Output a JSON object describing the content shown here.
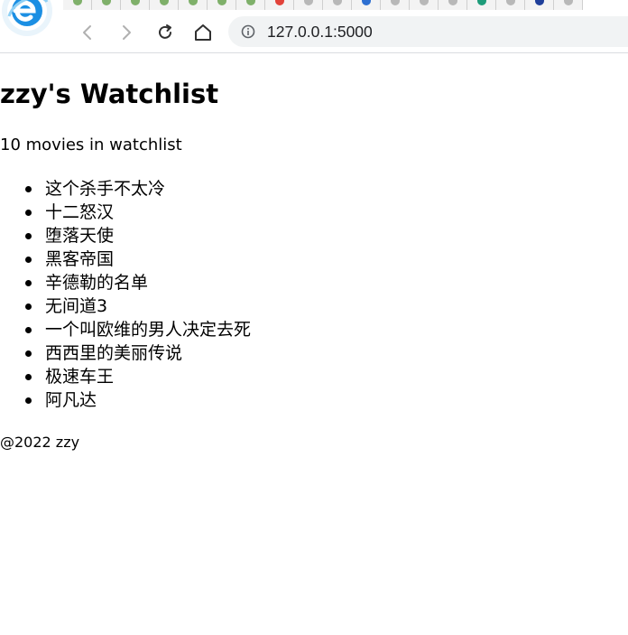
{
  "browser": {
    "url": "127.0.0.1:5000",
    "tabs": [
      {
        "icon": "tab-favicon",
        "color": "#7fb06a"
      },
      {
        "icon": "tab-favicon",
        "color": "#7fb06a"
      },
      {
        "icon": "tab-favicon",
        "color": "#7fb06a"
      },
      {
        "icon": "tab-favicon",
        "color": "#7fb06a"
      },
      {
        "icon": "tab-favicon",
        "color": "#7fb06a"
      },
      {
        "icon": "tab-favicon",
        "color": "#7fb06a"
      },
      {
        "icon": "tab-favicon",
        "color": "#7fb06a"
      },
      {
        "icon": "tab-favicon",
        "color": "#e2433a"
      },
      {
        "icon": "tab-favicon",
        "color": "#b8b8b8"
      },
      {
        "icon": "tab-favicon",
        "color": "#b8b8b8"
      },
      {
        "icon": "tab-favicon",
        "color": "#2d6fd1"
      },
      {
        "icon": "tab-favicon",
        "color": "#b8b8b8"
      },
      {
        "icon": "tab-favicon",
        "color": "#b8b8b8"
      },
      {
        "icon": "tab-favicon",
        "color": "#b8b8b8"
      },
      {
        "icon": "tab-favicon",
        "color": "#1e9c7a"
      },
      {
        "icon": "tab-favicon",
        "color": "#b8b8b8"
      },
      {
        "icon": "tab-favicon",
        "color": "#1f3f9a"
      },
      {
        "icon": "tab-favicon",
        "color": "#b8b8b8"
      }
    ],
    "icons": {
      "logo": "browser-logo-icon",
      "back": "arrow-left-icon",
      "forward": "arrow-right-icon",
      "reload": "reload-icon",
      "home": "home-icon",
      "info": "info-icon"
    },
    "colors": {
      "logo_blue": "#1b8fe3",
      "omnibox_bg": "#f1f3f4"
    }
  },
  "page": {
    "title": "zzy's Watchlist",
    "count_text": "10 movies in watchlist",
    "movies": [
      "这个杀手不太冷",
      "十二怒汉",
      "堕落天使",
      "黑客帝国",
      "辛德勒的名单",
      "无间道3",
      "一个叫欧维的男人决定去死",
      "西西里的美丽传说",
      "极速车王",
      "阿凡达"
    ],
    "footer": "@2022 zzy"
  }
}
